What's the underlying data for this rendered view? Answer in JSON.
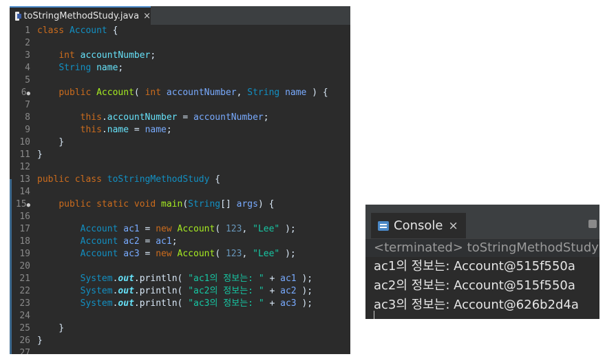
{
  "editor": {
    "tab_title": "toStringMethodStudy.java",
    "tab_close": "×",
    "lines": [
      {
        "num": "1",
        "dot": "",
        "tokens": [
          {
            "c": "k",
            "t": "class "
          },
          {
            "c": "t",
            "t": "Account"
          },
          {
            "c": "w",
            "t": " {"
          }
        ]
      },
      {
        "num": "2",
        "dot": "",
        "tokens": []
      },
      {
        "num": "3",
        "dot": "",
        "tokens": [
          {
            "c": "w",
            "t": "    "
          },
          {
            "c": "k",
            "t": "int "
          },
          {
            "c": "v",
            "t": "accountNumber"
          },
          {
            "c": "w",
            "t": ";"
          }
        ]
      },
      {
        "num": "4",
        "dot": "",
        "tokens": [
          {
            "c": "w",
            "t": "    "
          },
          {
            "c": "t",
            "t": "String "
          },
          {
            "c": "v",
            "t": "name"
          },
          {
            "c": "w",
            "t": ";"
          }
        ]
      },
      {
        "num": "5",
        "dot": "",
        "tokens": []
      },
      {
        "num": "6",
        "dot": "●",
        "tokens": [
          {
            "c": "w",
            "t": "    "
          },
          {
            "c": "k",
            "t": "public "
          },
          {
            "c": "m",
            "t": "Account"
          },
          {
            "c": "w",
            "t": "( "
          },
          {
            "c": "k",
            "t": "int "
          },
          {
            "c": "p",
            "t": "accountNumber"
          },
          {
            "c": "w",
            "t": ", "
          },
          {
            "c": "t",
            "t": "String "
          },
          {
            "c": "p",
            "t": "name"
          },
          {
            "c": "w",
            "t": " ) {"
          }
        ]
      },
      {
        "num": "7",
        "dot": "",
        "tokens": []
      },
      {
        "num": "8",
        "dot": "",
        "tokens": [
          {
            "c": "w",
            "t": "        "
          },
          {
            "c": "k",
            "t": "this"
          },
          {
            "c": "w",
            "t": "."
          },
          {
            "c": "v",
            "t": "accountNumber"
          },
          {
            "c": "w",
            "t": " = "
          },
          {
            "c": "p",
            "t": "accountNumber"
          },
          {
            "c": "w",
            "t": ";"
          }
        ]
      },
      {
        "num": "9",
        "dot": "",
        "tokens": [
          {
            "c": "w",
            "t": "        "
          },
          {
            "c": "k",
            "t": "this"
          },
          {
            "c": "w",
            "t": "."
          },
          {
            "c": "v",
            "t": "name"
          },
          {
            "c": "w",
            "t": " = "
          },
          {
            "c": "p",
            "t": "name"
          },
          {
            "c": "w",
            "t": ";"
          }
        ]
      },
      {
        "num": "10",
        "dot": "",
        "tokens": [
          {
            "c": "w",
            "t": "    }"
          }
        ]
      },
      {
        "num": "11",
        "dot": "",
        "tokens": [
          {
            "c": "w",
            "t": "}"
          }
        ]
      },
      {
        "num": "12",
        "dot": "",
        "tokens": []
      },
      {
        "num": "13",
        "dot": "",
        "tokens": [
          {
            "c": "k",
            "t": "public class "
          },
          {
            "c": "t",
            "t": "toStringMethodStudy"
          },
          {
            "c": "w",
            "t": " {"
          }
        ]
      },
      {
        "num": "14",
        "dot": "",
        "tokens": []
      },
      {
        "num": "15",
        "dot": "●",
        "tokens": [
          {
            "c": "w",
            "t": "    "
          },
          {
            "c": "k",
            "t": "public static void "
          },
          {
            "c": "m",
            "t": "main"
          },
          {
            "c": "w",
            "t": "("
          },
          {
            "c": "t",
            "t": "String"
          },
          {
            "c": "w",
            "t": "[] "
          },
          {
            "c": "p",
            "t": "args"
          },
          {
            "c": "w",
            "t": ") {"
          }
        ]
      },
      {
        "num": "16",
        "dot": "",
        "tokens": []
      },
      {
        "num": "17",
        "dot": "",
        "tokens": [
          {
            "c": "w",
            "t": "        "
          },
          {
            "c": "t",
            "t": "Account "
          },
          {
            "c": "p",
            "t": "ac1"
          },
          {
            "c": "w",
            "t": " = "
          },
          {
            "c": "k",
            "t": "new "
          },
          {
            "c": "m",
            "t": "Account"
          },
          {
            "c": "w",
            "t": "( "
          },
          {
            "c": "n",
            "t": "123"
          },
          {
            "c": "w",
            "t": ", "
          },
          {
            "c": "s",
            "t": "\"Lee\""
          },
          {
            "c": "w",
            "t": " );"
          }
        ]
      },
      {
        "num": "18",
        "dot": "",
        "tokens": [
          {
            "c": "w",
            "t": "        "
          },
          {
            "c": "t",
            "t": "Account "
          },
          {
            "c": "p",
            "t": "ac2"
          },
          {
            "c": "w",
            "t": " = "
          },
          {
            "c": "p",
            "t": "ac1"
          },
          {
            "c": "w",
            "t": ";"
          }
        ]
      },
      {
        "num": "19",
        "dot": "",
        "tokens": [
          {
            "c": "w",
            "t": "        "
          },
          {
            "c": "t",
            "t": "Account "
          },
          {
            "c": "p",
            "t": "ac3"
          },
          {
            "c": "w",
            "t": " = "
          },
          {
            "c": "k",
            "t": "new "
          },
          {
            "c": "m",
            "t": "Account"
          },
          {
            "c": "w",
            "t": "( "
          },
          {
            "c": "n",
            "t": "123"
          },
          {
            "c": "w",
            "t": ", "
          },
          {
            "c": "s",
            "t": "\"Lee\""
          },
          {
            "c": "w",
            "t": " );"
          }
        ]
      },
      {
        "num": "20",
        "dot": "",
        "tokens": []
      },
      {
        "num": "21",
        "dot": "",
        "tokens": [
          {
            "c": "w",
            "t": "        "
          },
          {
            "c": "t",
            "t": "System"
          },
          {
            "c": "w",
            "t": "."
          },
          {
            "c": "v it",
            "t": "out"
          },
          {
            "c": "w",
            "t": ".println( "
          },
          {
            "c": "s",
            "t": "\"ac1의 정보는: \""
          },
          {
            "c": "w",
            "t": " + "
          },
          {
            "c": "p",
            "t": "ac1"
          },
          {
            "c": "w",
            "t": " );"
          }
        ]
      },
      {
        "num": "22",
        "dot": "",
        "tokens": [
          {
            "c": "w",
            "t": "        "
          },
          {
            "c": "t",
            "t": "System"
          },
          {
            "c": "w",
            "t": "."
          },
          {
            "c": "v it",
            "t": "out"
          },
          {
            "c": "w",
            "t": ".println( "
          },
          {
            "c": "s",
            "t": "\"ac2의 정보는: \""
          },
          {
            "c": "w",
            "t": " + "
          },
          {
            "c": "p",
            "t": "ac2"
          },
          {
            "c": "w",
            "t": " );"
          }
        ]
      },
      {
        "num": "23",
        "dot": "",
        "tokens": [
          {
            "c": "w",
            "t": "        "
          },
          {
            "c": "t",
            "t": "System"
          },
          {
            "c": "w",
            "t": "."
          },
          {
            "c": "v it",
            "t": "out"
          },
          {
            "c": "w",
            "t": ".println( "
          },
          {
            "c": "s",
            "t": "\"ac3의 정보는: \""
          },
          {
            "c": "w",
            "t": " + "
          },
          {
            "c": "p",
            "t": "ac3"
          },
          {
            "c": "w",
            "t": " );"
          }
        ]
      },
      {
        "num": "24",
        "dot": "",
        "tokens": []
      },
      {
        "num": "25",
        "dot": "",
        "tokens": [
          {
            "c": "w",
            "t": "    }"
          }
        ]
      },
      {
        "num": "26",
        "dot": "",
        "tokens": [
          {
            "c": "w",
            "t": "}"
          }
        ]
      },
      {
        "num": "27",
        "dot": "",
        "tokens": []
      }
    ]
  },
  "console": {
    "tab_title": "Console",
    "tab_close": "×",
    "status": "<terminated> toStringMethodStudy [",
    "output": [
      "ac1의 정보는: Account@515f550a",
      "ac2의 정보는: Account@515f550a",
      "ac3의 정보는: Account@626b2d4a"
    ]
  }
}
